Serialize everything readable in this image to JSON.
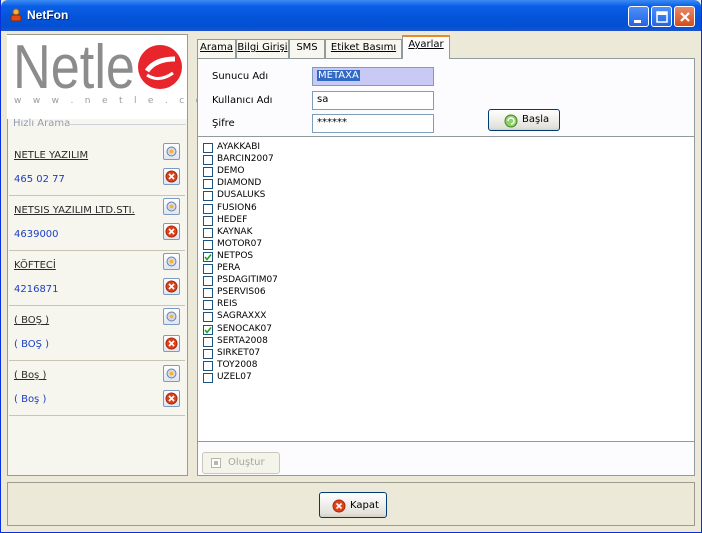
{
  "window": {
    "title": "NetFon"
  },
  "logo": {
    "text": "Netle",
    "url_text": "w w w . n e t l e . c o m . t r"
  },
  "sidebar": {
    "section_title": "Hızlı Arama",
    "contacts": [
      {
        "name": "NETLE YAZILIM",
        "phone": "465 02 77"
      },
      {
        "name": "NETSIS YAZILIM LTD.STI.",
        "phone": "4639000"
      },
      {
        "name": "KÖFTECİ",
        "phone": "4216871"
      },
      {
        "name": "( BOŞ )",
        "phone": "( BOŞ )"
      },
      {
        "name": "( Boş )",
        "phone": "( Boş )"
      }
    ]
  },
  "tabs": [
    {
      "label": "Arama",
      "active": false
    },
    {
      "label": "Bilgi Girişi",
      "active": false
    },
    {
      "label": "SMS",
      "active": false
    },
    {
      "label": "Etiket Basımı",
      "active": false
    },
    {
      "label": "Ayarlar",
      "active": true
    }
  ],
  "settings": {
    "server_label": "Sunucu Adı",
    "server_value": "METAXA",
    "user_label": "Kullanıcı Adı",
    "user_value": "sa",
    "password_label": "Şifre",
    "password_value": "******",
    "start_button": "Başla"
  },
  "databases": [
    {
      "name": "AYAKKABI",
      "checked": false
    },
    {
      "name": "BARCIN2007",
      "checked": false
    },
    {
      "name": "DEMO",
      "checked": false
    },
    {
      "name": "DIAMOND",
      "checked": false
    },
    {
      "name": "DUSALUKS",
      "checked": false
    },
    {
      "name": "FUSION6",
      "checked": false
    },
    {
      "name": "HEDEF",
      "checked": false
    },
    {
      "name": "KAYNAK",
      "checked": false
    },
    {
      "name": "MOTOR07",
      "checked": false
    },
    {
      "name": "NETPOS",
      "checked": true
    },
    {
      "name": "PERA",
      "checked": false
    },
    {
      "name": "PSDAGITIM07",
      "checked": false
    },
    {
      "name": "PSERVIS06",
      "checked": false
    },
    {
      "name": "REIS",
      "checked": false
    },
    {
      "name": "SAGRAXXX",
      "checked": false
    },
    {
      "name": "SENOCAK07",
      "checked": true
    },
    {
      "name": "SERTA2008",
      "checked": false
    },
    {
      "name": "SIRKET07",
      "checked": false
    },
    {
      "name": "TOY2008",
      "checked": false
    },
    {
      "name": "UZEL07",
      "checked": false
    }
  ],
  "create_button": "Oluştur",
  "close_button": "Kapat",
  "colors": {
    "titlebar": "#0453d8",
    "logo_red": "#e8252b",
    "logo_grey": "#8c8c8c",
    "link_blue": "#1a3ec4"
  }
}
